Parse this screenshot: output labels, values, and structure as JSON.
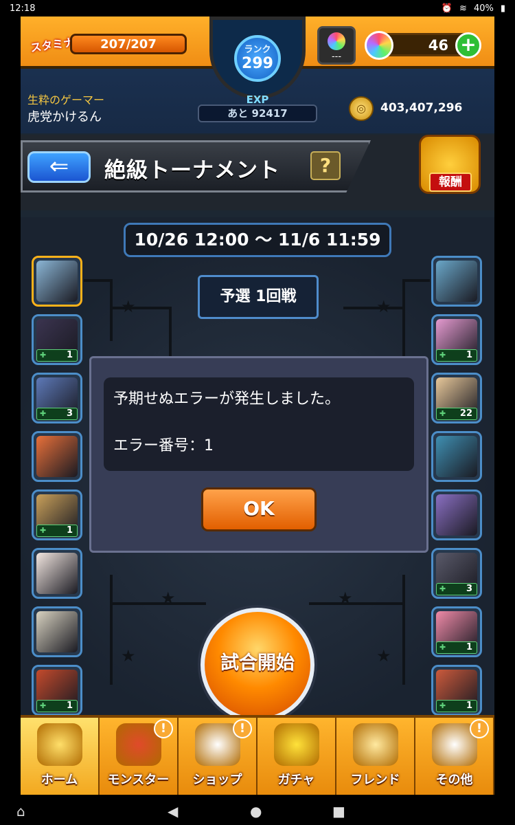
{
  "status_bar": {
    "time": "12:18",
    "battery": "40%"
  },
  "header": {
    "stamina_label": "スタミナ",
    "stamina_value": "207/207",
    "rank_label": "ランク",
    "rank_value": "299",
    "exp_label": "EXP",
    "exp_remaining": "あと 92417",
    "item_count": "---",
    "gems": "46",
    "player_title": "生粋のゲーマー",
    "player_name": "虎党かけるん",
    "coins": "403,407,296"
  },
  "title_bar": {
    "title": "絶級トーナメント",
    "help": "?",
    "reward_label": "報酬"
  },
  "bracket": {
    "period": "10/26 12:00 ～ 11/6 11:59",
    "round": "予選 1回戦",
    "left_slots": [
      {
        "badge": ""
      },
      {
        "badge": "1"
      },
      {
        "badge": "3"
      },
      {
        "badge": ""
      },
      {
        "badge": "1"
      },
      {
        "badge": ""
      },
      {
        "badge": ""
      },
      {
        "badge": "1"
      }
    ],
    "right_slots": [
      {
        "badge": ""
      },
      {
        "badge": "1"
      },
      {
        "badge": "22"
      },
      {
        "badge": ""
      },
      {
        "badge": ""
      },
      {
        "badge": "3"
      },
      {
        "badge": "1"
      },
      {
        "badge": "1"
      }
    ]
  },
  "dialog": {
    "message": "予期せぬエラーが発生しました。",
    "error_code": "エラー番号：1",
    "ok": "OK"
  },
  "start_button": "試合開始",
  "nav": [
    {
      "label": "ホーム",
      "alert": ""
    },
    {
      "label": "モンスター",
      "alert": "!"
    },
    {
      "label": "ショップ",
      "alert": "!"
    },
    {
      "label": "ガチャ",
      "alert": ""
    },
    {
      "label": "フレンド",
      "alert": ""
    },
    {
      "label": "その他",
      "alert": "!"
    }
  ],
  "colors": {
    "accent": "#f08d14",
    "dialog_bg": "#373d56",
    "ok_button": "#e25f00"
  }
}
